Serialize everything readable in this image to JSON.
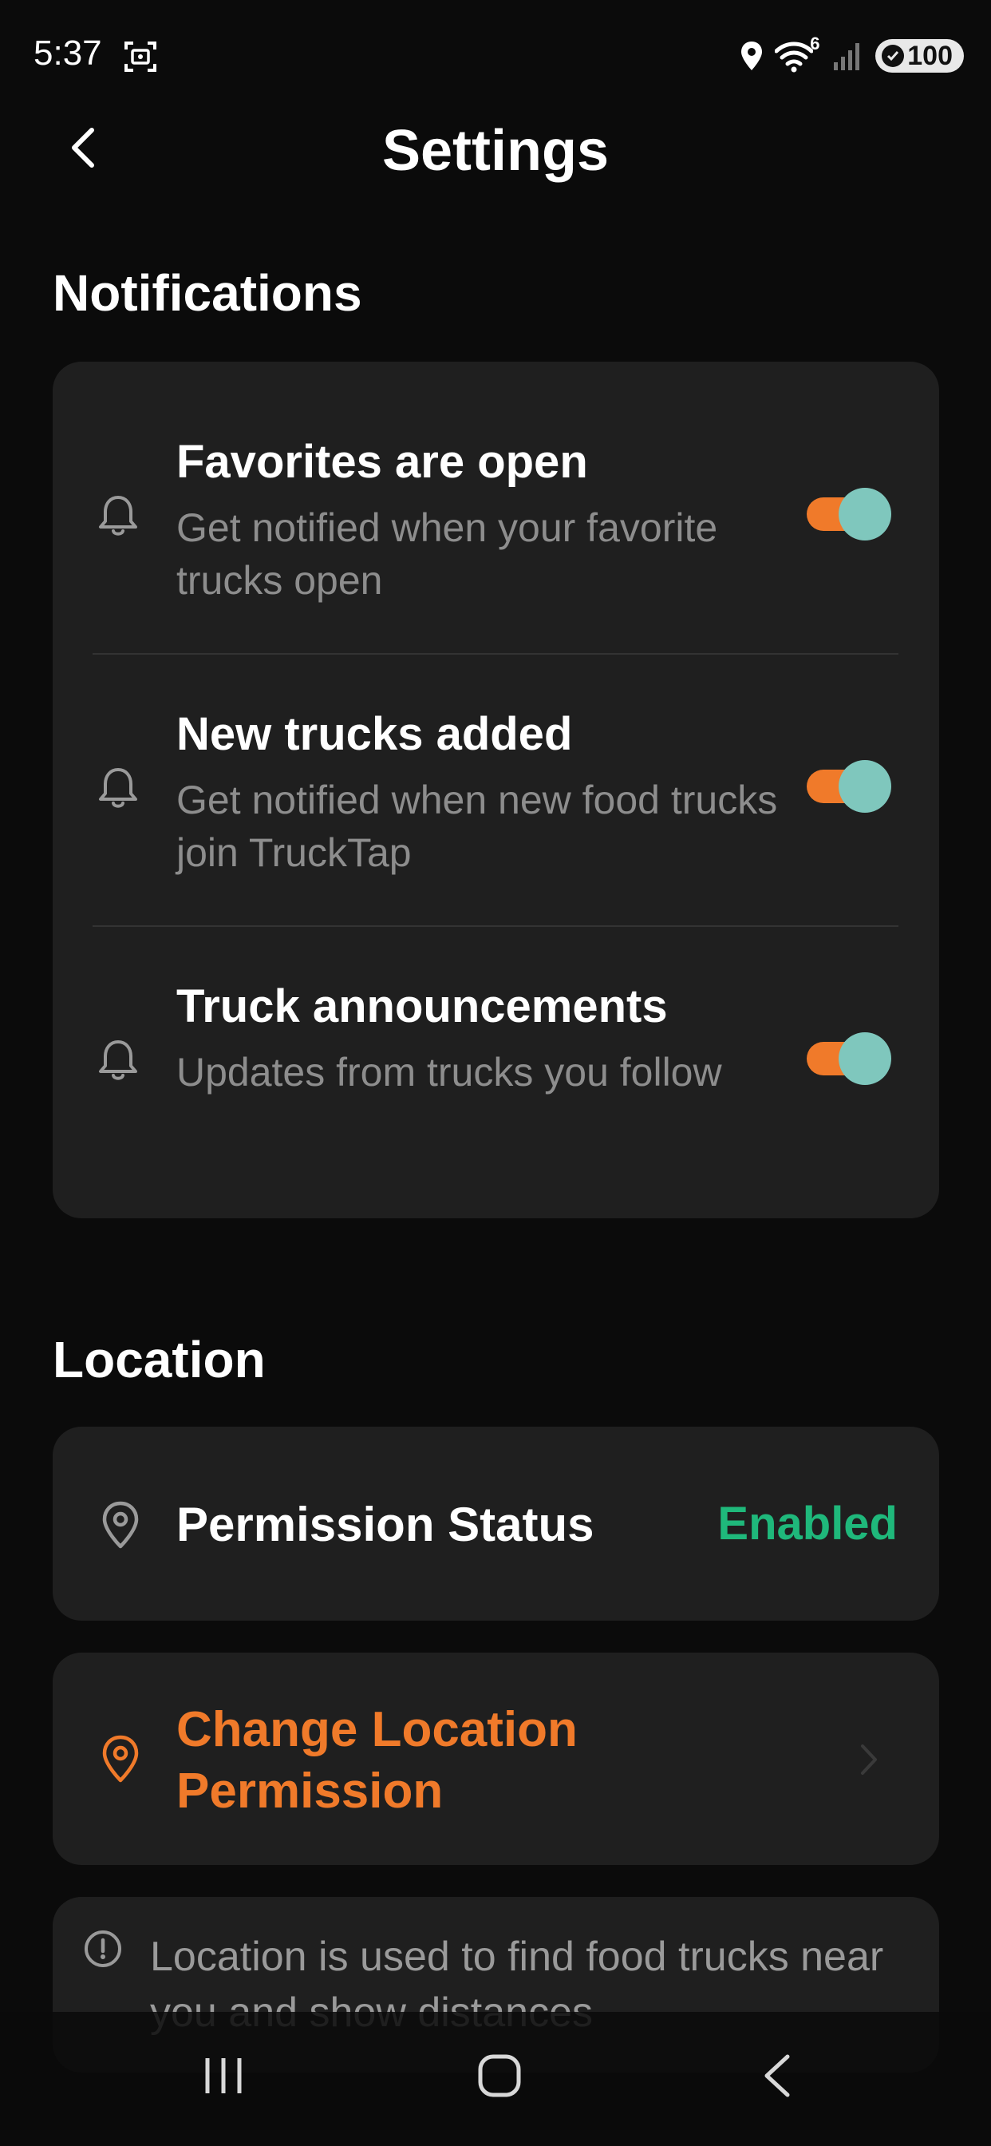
{
  "status_bar": {
    "time": "5:37",
    "network_superscript": "6",
    "battery": "100"
  },
  "header": {
    "title": "Settings"
  },
  "notifications": {
    "section_title": "Notifications",
    "items": [
      {
        "title": "Favorites are open",
        "description": "Get notified when your favorite trucks open",
        "enabled": true
      },
      {
        "title": "New trucks added",
        "description": "Get notified when new food trucks join TruckTap",
        "enabled": true
      },
      {
        "title": "Truck announcements",
        "description": "Updates from trucks you follow",
        "enabled": true
      }
    ]
  },
  "location": {
    "section_title": "Location",
    "permission_label": "Permission Status",
    "permission_value": "Enabled",
    "change_label": "Change Location Permission",
    "info_text": "Location is used to find food trucks near you and show distances"
  },
  "colors": {
    "background": "#0b0b0b",
    "card": "#1f1f1f",
    "accent_orange": "#f07a2a",
    "toggle_knob": "#7fc7bd",
    "enabled_green": "#1fb87b",
    "secondary_text": "#8d8d8d"
  },
  "icons": {
    "back": "chevron-left-icon",
    "notification": "bell-icon",
    "location": "map-pin-icon",
    "chevron": "chevron-right-icon",
    "info": "info-circle-icon"
  }
}
